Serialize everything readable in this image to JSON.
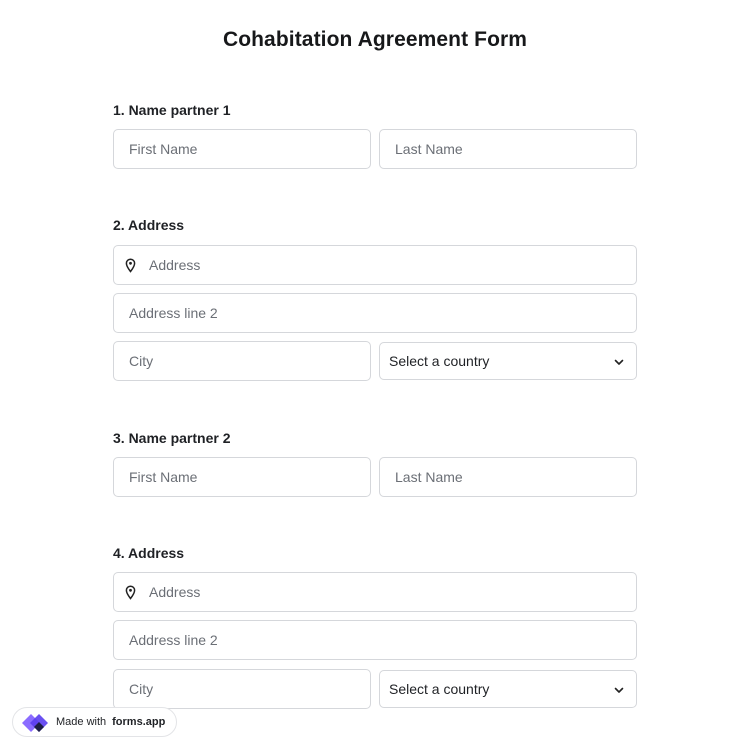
{
  "form": {
    "title": "Cohabitation Agreement Form"
  },
  "questions": [
    {
      "label": "1.  Name partner 1",
      "first_placeholder": "First Name",
      "last_placeholder": "Last Name"
    },
    {
      "label": "2. Address",
      "address_placeholder": "Address",
      "address2_placeholder": "Address line 2",
      "city_placeholder": "City",
      "country_value": "Select a country"
    },
    {
      "label": "3. Name partner 2",
      "first_placeholder": "First Name",
      "last_placeholder": "Last Name"
    },
    {
      "label": "4. Address",
      "address_placeholder": "Address",
      "address2_placeholder": "Address line 2",
      "city_placeholder": "City",
      "country_value": "Select a country"
    }
  ],
  "badge": {
    "prefix": "Made with",
    "brand": "forms.app"
  },
  "icons": {
    "address": "map-pin-icon",
    "select": "chevron-down-icon",
    "logo": "forms-app-logo-icon"
  },
  "colors": {
    "logo_purple": "#6c47ff",
    "logo_dark": "#1d1e45"
  }
}
